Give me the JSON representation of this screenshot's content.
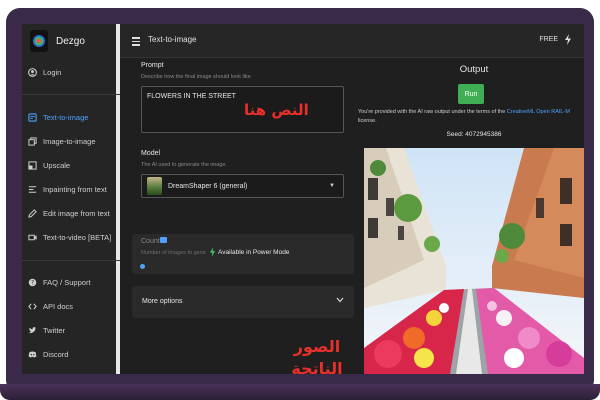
{
  "app": {
    "name": "Dezgo"
  },
  "sidebar": {
    "login": "Login",
    "items": [
      {
        "label": "Text-to-image",
        "icon": "text-image-icon",
        "active": true
      },
      {
        "label": "Image-to-image",
        "icon": "image-image-icon",
        "active": false
      },
      {
        "label": "Upscale",
        "icon": "upscale-icon",
        "active": false
      },
      {
        "label": "Inpainting from text",
        "icon": "inpainting-icon",
        "active": false
      },
      {
        "label": "Edit image from text",
        "icon": "edit-icon",
        "active": false
      },
      {
        "label": "Text-to-video [BETA]",
        "icon": "video-icon",
        "active": false
      }
    ],
    "footer": [
      {
        "label": "FAQ / Support",
        "icon": "help-icon"
      },
      {
        "label": "API docs",
        "icon": "code-icon"
      },
      {
        "label": "Twitter",
        "icon": "twitter-icon"
      },
      {
        "label": "Discord",
        "icon": "discord-icon"
      }
    ]
  },
  "topbar": {
    "title": "Text-to-image",
    "plan": "FREE"
  },
  "form": {
    "prompt_label": "Prompt",
    "prompt_desc": "Describe how the final image should look like",
    "prompt_value": "FLOWERS IN THE STREET",
    "prompt_overlay": "النص هنا",
    "model_label": "Model",
    "model_desc": "The AI used to generate the image.",
    "model_value": "DreamShaper 6 (general)",
    "count_label": "Count",
    "count_desc": "Number of images to gene",
    "count_power": "Available in Power Mode",
    "more_options": "More options"
  },
  "output": {
    "title": "Output",
    "run": "Run",
    "license_prefix": "You're provided with the AI raw output under the terms of the ",
    "license_link": "CreativeML Open RAIL-M",
    "license_suffix": "license.",
    "seed": "Seed: 4072945386",
    "image_overlay_line1": "الصور",
    "image_overlay_line2": "الناتجة"
  },
  "colors": {
    "accent": "#4ea1ff",
    "run": "#3fae55",
    "overlay_text": "#e8302a"
  }
}
